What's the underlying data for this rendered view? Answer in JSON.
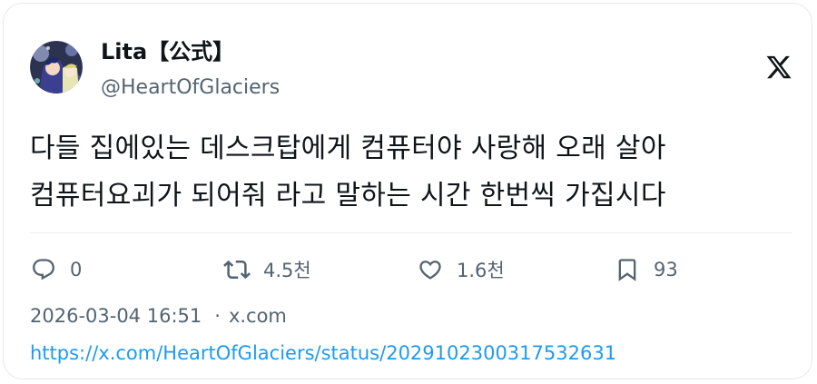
{
  "author": {
    "display_name": "Lita【公式】",
    "handle": "@HeartOfGlaciers"
  },
  "tweet": {
    "lines": [
      "다들 집에있는 데스크탑에게 컴퓨터야 사랑해 오래 살아",
      "컴퓨터요괴가 되어줘 라고 말하는 시간 한번씩 가집시다"
    ]
  },
  "actions": {
    "reply": {
      "icon": "reply-icon",
      "count": "0"
    },
    "retweet": {
      "icon": "retweet-icon",
      "count": "4.5천"
    },
    "like": {
      "icon": "heart-icon",
      "count": "1.6천"
    },
    "bookmark": {
      "icon": "bookmark-icon",
      "count": "93"
    }
  },
  "meta": {
    "timestamp": "2026-03-04 16:51",
    "separator": "·",
    "source": "x.com"
  },
  "link": {
    "url": "https://x.com/HeartOfGlaciers/status/2029102300317532631"
  },
  "colors": {
    "text": "#0f1419",
    "secondary": "#536471",
    "link": "#1d9bf0",
    "border": "#e6e8eb"
  },
  "brand": {
    "icon": "x-logo-icon"
  }
}
